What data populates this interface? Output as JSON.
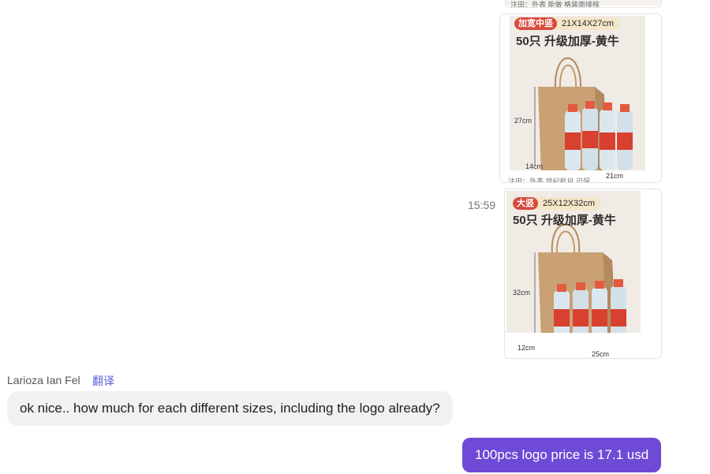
{
  "messages": {
    "card_top": {
      "dimension": "cm",
      "caption": "注田：外表 能做 格装面接核"
    },
    "card_1": {
      "tag": "加宽中竖",
      "size": "21X14X27cm",
      "title": "50只 升级加厚-黄牛",
      "height_label": "27cm",
      "depth_label": "14cm",
      "width_label": "21cm",
      "caption": "注田：外表 世纪批目 可保"
    },
    "timestamp": "15:59",
    "card_2": {
      "tag": "大竖",
      "size": "25X12X32cm",
      "title": "50只 升级加厚-黄牛",
      "height_label": "32cm",
      "depth_label": "12cm",
      "width_label": "25cm"
    },
    "incoming": {
      "sender": "Larioza Ian Fel",
      "translate_label": "翻译",
      "text": "ok nice.. how much for each different sizes, including the logo already?"
    },
    "outgoing": {
      "text": "100pcs logo price is 17.1 usd"
    }
  },
  "colors": {
    "outgoing_bubble": "#6e4ad6",
    "incoming_bubble": "#f1f1f3",
    "tag_red": "#d64b3c",
    "translate_link": "#5b5fd8"
  }
}
